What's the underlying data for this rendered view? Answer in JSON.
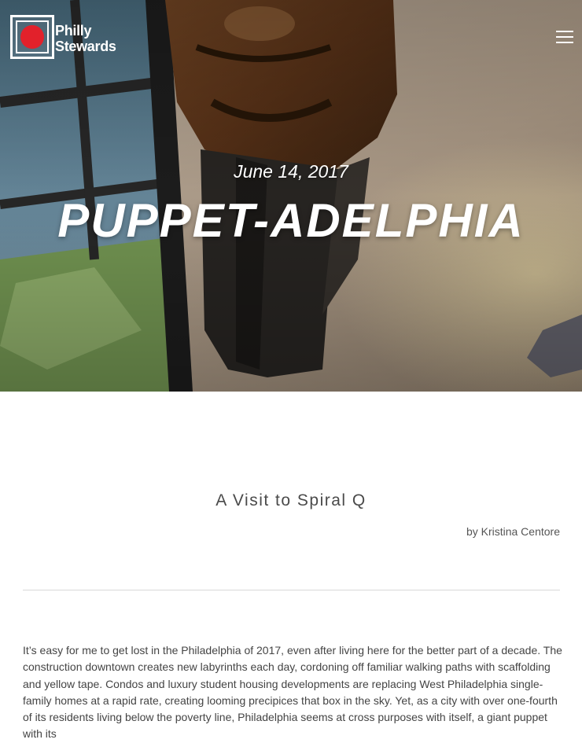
{
  "header": {
    "logo": {
      "line1": "Philly",
      "line2": "Stewards",
      "accent_color": "#e2212b"
    },
    "menu_icon": "hamburger-menu-icon"
  },
  "hero": {
    "date": "June 14, 2017",
    "title": "PUPPET-ADELPHIA"
  },
  "article": {
    "subtitle": "A Visit to Spiral Q",
    "author": "by Kristina Centore",
    "body": "It’s easy for me to get lost in the Philadelphia of 2017, even after living here for the better part of a decade. The construction downtown creates new labyrinths each day, cordoning off familiar walking paths with scaffolding and yellow tape. Condos and luxury student housing developments are replacing West Philadelphia single-family homes at a rapid rate, creating looming precipices that box in the sky.  Yet, as a city with over one-fourth of its residents living below the poverty line, Philadelphia seems at cross purposes with itself, a giant puppet with its"
  }
}
